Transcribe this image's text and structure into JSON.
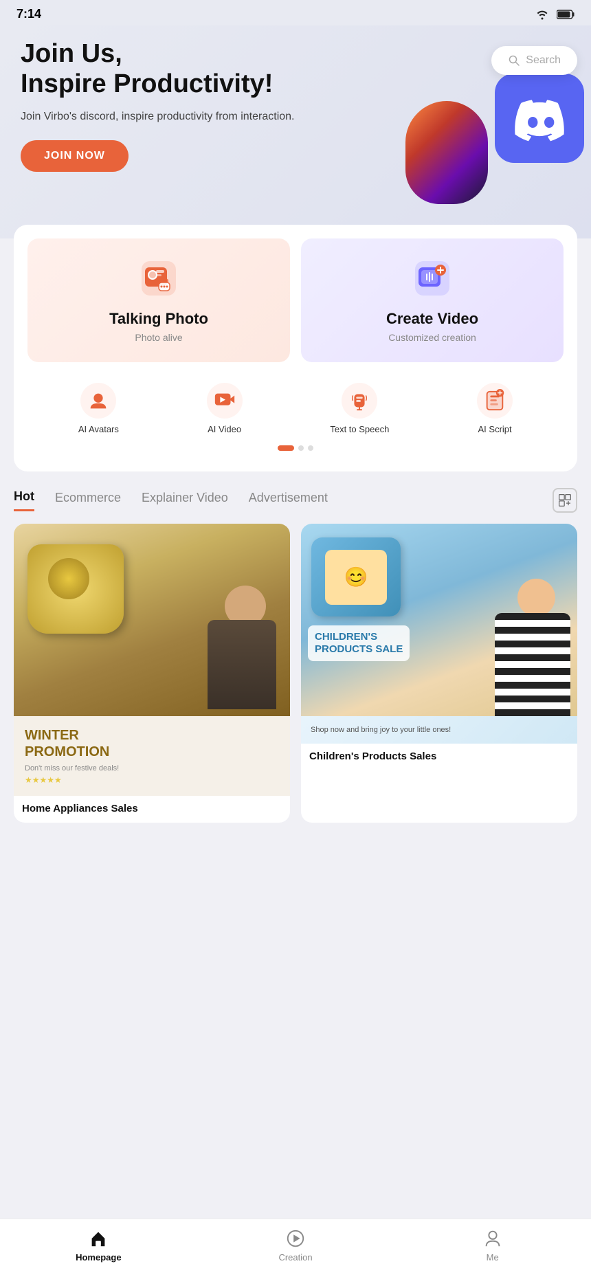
{
  "statusBar": {
    "time": "7:14",
    "wifiIcon": "wifi-icon",
    "batteryIcon": "battery-icon"
  },
  "hero": {
    "title": "Join Us,\nInspire Productivity!",
    "description": "Join Virbo's discord, inspire productivity from interaction.",
    "buttonLabel": "JOIN NOW",
    "searchPlaceholder": "Search"
  },
  "featureCards": [
    {
      "id": "talking-photo",
      "title": "Talking Photo",
      "subtitle": "Photo alive",
      "theme": "pink"
    },
    {
      "id": "create-video",
      "title": "Create Video",
      "subtitle": "Customized creation",
      "theme": "purple"
    }
  ],
  "quickActions": [
    {
      "id": "ai-avatars",
      "label": "AI Avatars"
    },
    {
      "id": "ai-video",
      "label": "AI Video"
    },
    {
      "id": "text-to-speech",
      "label": "Text to Speech"
    },
    {
      "id": "ai-script",
      "label": "AI Script"
    }
  ],
  "tabs": [
    {
      "id": "hot",
      "label": "Hot",
      "active": true
    },
    {
      "id": "ecommerce",
      "label": "Ecommerce",
      "active": false
    },
    {
      "id": "explainer",
      "label": "Explainer Video",
      "active": false
    },
    {
      "id": "advertisement",
      "label": "Advertisement",
      "active": false
    }
  ],
  "videoCards": [
    {
      "id": "home-appliances",
      "promoTitle": "WINTER\nPROMOTION",
      "promoDesc": "Don't miss our festive deals!",
      "title": "Home Appliances Sales",
      "hasStars": true
    },
    {
      "id": "children-products",
      "promoTitle": "CHILDREN'S\nPRODUCTS SALE",
      "promoDesc": "Shop now and bring joy to your little ones!",
      "title": "Children's Products Sales",
      "hasStars": false
    }
  ],
  "bottomNav": [
    {
      "id": "homepage",
      "label": "Homepage",
      "active": true
    },
    {
      "id": "creation",
      "label": "Creation",
      "active": false
    },
    {
      "id": "me",
      "label": "Me",
      "active": false
    }
  ]
}
